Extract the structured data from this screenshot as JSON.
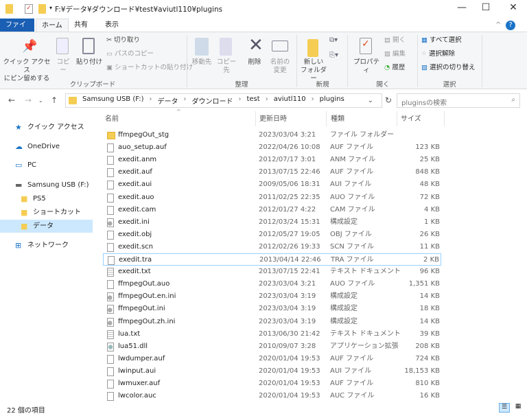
{
  "window": {
    "title": "F:¥データ¥ダウンロード¥test¥aviutl110¥plugins",
    "minimize": "—",
    "maximize": "☐",
    "close": "✕"
  },
  "tabs": [
    "ファイル",
    "ホーム",
    "共有",
    "表示"
  ],
  "ribbon": {
    "pin": "クイック アクセス\nにピン留めする",
    "copy": "コピー",
    "paste": "貼り付け",
    "cut": "切り取り",
    "copy_path": "パスのコピー",
    "paste_shortcut": "ショートカットの貼り付け",
    "group_clipboard": "クリップボード",
    "move_to": "移動先",
    "copy_to": "コピー先",
    "delete": "削除",
    "rename": "名前の\n変更",
    "group_organize": "整理",
    "new_folder": "新しい\nフォルダー",
    "group_new": "新規",
    "properties": "プロパティ",
    "open": "開く",
    "edit": "編集",
    "history": "履歴",
    "group_open": "開く",
    "select_all": "すべて選択",
    "select_none": "選択解除",
    "invert_selection": "選択の切り替え",
    "group_select": "選択"
  },
  "address": {
    "crumbs": [
      "Samsung USB (F:)",
      "›",
      "データ",
      "›",
      "ダウンロード",
      "›",
      "test",
      "›",
      "aviutl110",
      "›",
      "plugins"
    ],
    "search_placeholder": "pluginsの検索"
  },
  "sidebar": [
    {
      "label": "クイック アクセス",
      "icon": "star-icon"
    },
    {
      "label": "OneDrive",
      "icon": "cloud-icon"
    },
    {
      "label": "PC",
      "icon": "pc-icon"
    },
    {
      "label": "Samsung USB (F:)",
      "icon": "drive-icon"
    },
    {
      "label": "PS5",
      "icon": "folder-icon"
    },
    {
      "label": "ショートカット",
      "icon": "folder-icon"
    },
    {
      "label": "データ",
      "icon": "folder-icon",
      "selected": true
    },
    {
      "label": "ネットワーク",
      "icon": "network-icon"
    }
  ],
  "columns": {
    "name": "名前",
    "date": "更新日時",
    "type": "種類",
    "size": "サイズ"
  },
  "files": [
    {
      "name": "ffmpegOut_stg",
      "date": "2023/03/04 3:21",
      "type": "ファイル フォルダー",
      "size": "",
      "kind": "folder"
    },
    {
      "name": "auo_setup.auf",
      "date": "2022/04/26 10:08",
      "type": "AUF ファイル",
      "size": "123 KB",
      "kind": "file"
    },
    {
      "name": "exedit.anm",
      "date": "2012/07/17 3:01",
      "type": "ANM ファイル",
      "size": "25 KB",
      "kind": "file"
    },
    {
      "name": "exedit.auf",
      "date": "2013/07/15 22:46",
      "type": "AUF ファイル",
      "size": "848 KB",
      "kind": "file"
    },
    {
      "name": "exedit.aui",
      "date": "2009/05/06 18:31",
      "type": "AUI ファイル",
      "size": "48 KB",
      "kind": "file"
    },
    {
      "name": "exedit.auo",
      "date": "2011/02/25 22:35",
      "type": "AUO ファイル",
      "size": "72 KB",
      "kind": "file"
    },
    {
      "name": "exedit.cam",
      "date": "2012/01/27 4:22",
      "type": "CAM ファイル",
      "size": "4 KB",
      "kind": "file"
    },
    {
      "name": "exedit.ini",
      "date": "2012/03/24 15:31",
      "type": "構成設定",
      "size": "1 KB",
      "kind": "cfg"
    },
    {
      "name": "exedit.obj",
      "date": "2012/05/27 19:05",
      "type": "OBJ ファイル",
      "size": "26 KB",
      "kind": "file"
    },
    {
      "name": "exedit.scn",
      "date": "2012/02/26 19:33",
      "type": "SCN ファイル",
      "size": "11 KB",
      "kind": "file"
    },
    {
      "name": "exedit.tra",
      "date": "2013/04/14 22:46",
      "type": "TRA ファイル",
      "size": "2 KB",
      "kind": "file",
      "focused": true
    },
    {
      "name": "exedit.txt",
      "date": "2013/07/15 22:41",
      "type": "テキスト ドキュメント",
      "size": "96 KB",
      "kind": "txt"
    },
    {
      "name": "ffmpegOut.auo",
      "date": "2023/03/04 3:21",
      "type": "AUO ファイル",
      "size": "1,351 KB",
      "kind": "file"
    },
    {
      "name": "ffmpegOut.en.ini",
      "date": "2023/03/04 3:19",
      "type": "構成設定",
      "size": "14 KB",
      "kind": "cfg"
    },
    {
      "name": "ffmpegOut.ini",
      "date": "2023/03/04 3:19",
      "type": "構成設定",
      "size": "18 KB",
      "kind": "cfg"
    },
    {
      "name": "ffmpegOut.zh.ini",
      "date": "2023/03/04 3:19",
      "type": "構成設定",
      "size": "14 KB",
      "kind": "cfg"
    },
    {
      "name": "lua.txt",
      "date": "2013/06/30 21:42",
      "type": "テキスト ドキュメント",
      "size": "39 KB",
      "kind": "txt"
    },
    {
      "name": "lua51.dll",
      "date": "2010/09/07 3:28",
      "type": "アプリケーション拡張",
      "size": "208 KB",
      "kind": "dll"
    },
    {
      "name": "lwdumper.auf",
      "date": "2020/01/04 19:53",
      "type": "AUF ファイル",
      "size": "724 KB",
      "kind": "file"
    },
    {
      "name": "lwinput.aui",
      "date": "2020/01/04 19:53",
      "type": "AUI ファイル",
      "size": "18,153 KB",
      "kind": "file"
    },
    {
      "name": "lwmuxer.auf",
      "date": "2020/01/04 19:53",
      "type": "AUF ファイル",
      "size": "810 KB",
      "kind": "file"
    },
    {
      "name": "lwcolor.auc",
      "date": "2020/01/04 19:53",
      "type": "AUC ファイル",
      "size": "16 KB",
      "kind": "file"
    }
  ],
  "status": {
    "count": "22 個の項目"
  }
}
